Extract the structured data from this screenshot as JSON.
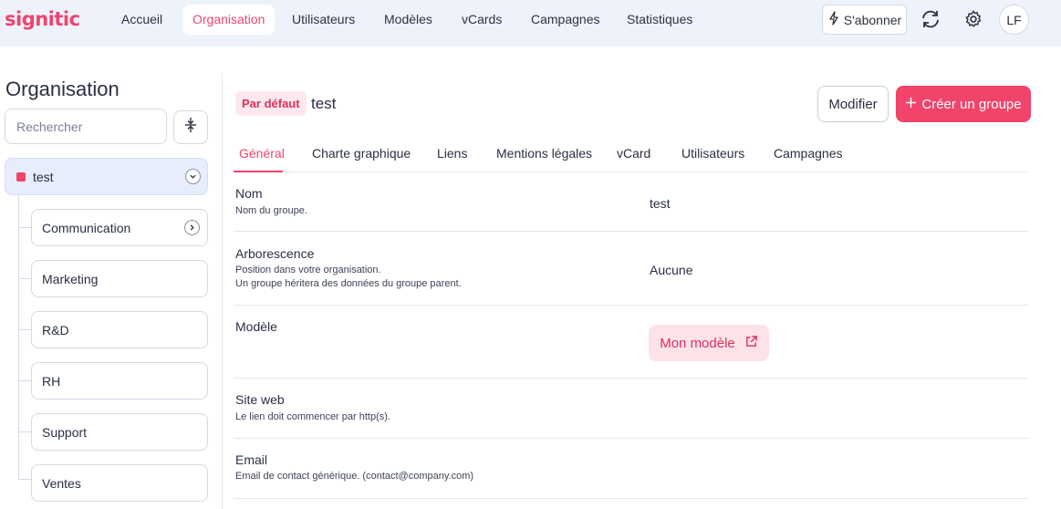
{
  "app": {
    "logo": "signitic",
    "brand_color": "#f0446b"
  },
  "nav": {
    "items": [
      {
        "label": "Accueil",
        "active": false
      },
      {
        "label": "Organisation",
        "active": true
      },
      {
        "label": "Utilisateurs",
        "active": false
      },
      {
        "label": "Modèles",
        "active": false
      },
      {
        "label": "vCards",
        "active": false
      },
      {
        "label": "Campagnes",
        "active": false
      },
      {
        "label": "Statistiques",
        "active": false
      }
    ],
    "subscribe_label": "S'abonner",
    "subscribe_icon": "lightning-icon",
    "sync_icon": "refresh-icon",
    "settings_icon": "gear-icon",
    "avatar_initials": "LF"
  },
  "sidebar": {
    "title": "Organisation",
    "search_placeholder": "Rechercher",
    "collapse_icon": "collapse-arrows-icon",
    "root": {
      "label": "test",
      "color": "#f0446b",
      "expanded": true
    },
    "children": [
      {
        "label": "Communication",
        "has_children": true
      },
      {
        "label": "Marketing",
        "has_children": false
      },
      {
        "label": "R&D",
        "has_children": false
      },
      {
        "label": "RH",
        "has_children": false
      },
      {
        "label": "Support",
        "has_children": false
      },
      {
        "label": "Ventes",
        "has_children": false
      }
    ]
  },
  "main": {
    "badge": "Par défaut",
    "group_name": "test",
    "modify_label": "Modifier",
    "create_label": "Créer un groupe",
    "tabs": [
      {
        "label": "Général",
        "active": true
      },
      {
        "label": "Charte graphique",
        "active": false
      },
      {
        "label": "Liens",
        "active": false
      },
      {
        "label": "Mentions légales",
        "active": false
      },
      {
        "label": "vCard",
        "active": false
      },
      {
        "label": "Utilisateurs",
        "active": false
      },
      {
        "label": "Campagnes",
        "active": false
      }
    ],
    "fields": {
      "name": {
        "label": "Nom",
        "description": "Nom du groupe.",
        "value": "test"
      },
      "tree": {
        "label": "Arborescence",
        "description_line1": "Position dans votre organisation.",
        "description_line2": "Un groupe héritera des données du groupe parent.",
        "value": "Aucune"
      },
      "model": {
        "label": "Modèle",
        "link_label": "Mon modèle",
        "link_icon": "external-link-icon"
      },
      "website": {
        "label": "Site web",
        "description": "Le lien doit commencer par http(s)."
      },
      "email": {
        "label": "Email",
        "description": "Email de contact générique. (contact@company.com)"
      }
    }
  }
}
